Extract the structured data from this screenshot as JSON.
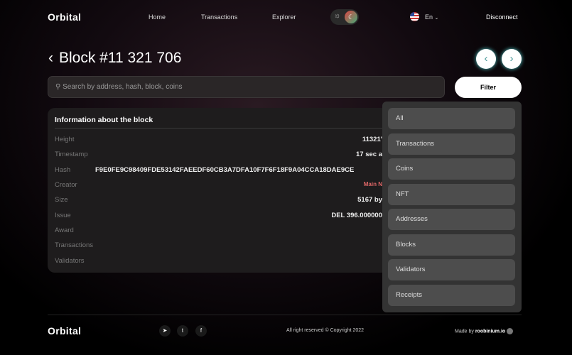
{
  "header": {
    "logo": "Orbital",
    "nav": [
      "Home",
      "Transactions",
      "Explorer"
    ],
    "theme_light": "☼",
    "theme_dark": "☾",
    "language": "En",
    "disconnect": "Disconnect"
  },
  "page": {
    "back": "‹",
    "title": "Block #11 321 706",
    "prev": "‹",
    "next": "›"
  },
  "search": {
    "placeholder": "Search by address, hash, block, coins",
    "filter": "Filter"
  },
  "card": {
    "title": "Information about the block",
    "rows": [
      {
        "label": "Height",
        "value": "11321'"
      },
      {
        "label": "Timestamp",
        "value": "17 sec a"
      },
      {
        "label": "Hash",
        "value": "F9E0FE9C98409FDE53142FAEEDF60CB3A7DFA10F7F6F18F9A04CCA18DAE9CE"
      },
      {
        "label": "Creator",
        "value": "Main N"
      },
      {
        "label": "Size",
        "value": "5167 by"
      },
      {
        "label": "Issue",
        "value": "DEL 396.000000"
      },
      {
        "label": "Award",
        "value": ""
      },
      {
        "label": "Transactions",
        "value": ""
      },
      {
        "label": "Validators",
        "value": ""
      }
    ]
  },
  "filter_menu": [
    "All",
    "Transactions",
    "Coins",
    "NFT",
    "Addresses",
    "Blocks",
    "Validators",
    "Receipts"
  ],
  "footer": {
    "logo": "Orbital",
    "copyright": "All right reserved © Copyright 2022",
    "made_by": "Made by",
    "brand": "roobinium.io"
  }
}
